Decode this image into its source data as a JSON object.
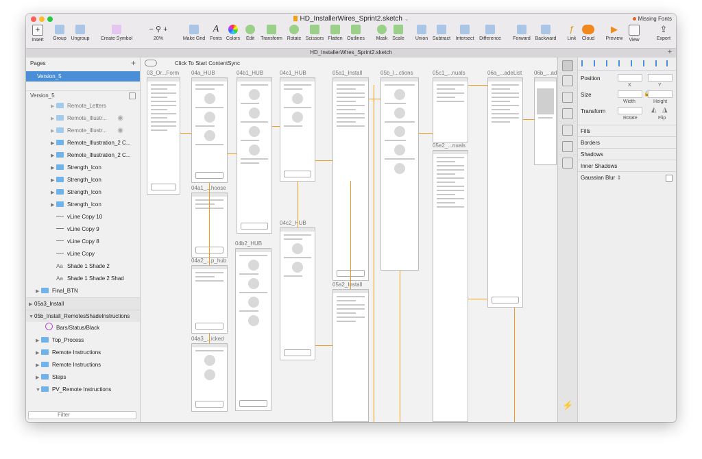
{
  "window": {
    "title": "HD_InstallerWires_Sprint2.sketch",
    "missing_fonts": "Missing Fonts",
    "tab_title": "HD_InstallerWires_Sprint2.sketch"
  },
  "toolbar": {
    "insert": "Insert",
    "group": "Group",
    "ungroup": "Ungroup",
    "create_symbol": "Create Symbol",
    "zoom": "20%",
    "make_grid": "Make Grid",
    "fonts": "Fonts",
    "colors": "Colors",
    "edit": "Edit",
    "transform": "Transform",
    "rotate": "Rotate",
    "scissors": "Scissors",
    "flatten": "Flatten",
    "outlines": "Outlines",
    "mask": "Mask",
    "scale": "Scale",
    "union": "Union",
    "subtract": "Subtract",
    "intersect": "Intersect",
    "difference": "Difference",
    "forward": "Forward",
    "backward": "Backward",
    "link": "Link",
    "cloud": "Cloud",
    "preview": "Preview",
    "view": "View",
    "export": "Export"
  },
  "pages": {
    "header": "Pages",
    "selected": "Version_5",
    "version_label": "Version_5"
  },
  "layers": [
    "Remote_Letters",
    "Remote_Illustr...",
    "Remote_Illustr...",
    "Remote_Illustration_2 C...",
    "Remote_Illustration_2 C...",
    "Strength_Icon",
    "Strength_Icon",
    "Strength_Icon",
    "Strength_Icon",
    "vLine Copy 10",
    "vLine Copy 9",
    "vLine Copy 8",
    "vLine Copy",
    "Shade 1 Shade 2",
    "Shade 1 Shade 2 Shad",
    "Final_BTN",
    "05a3_Install",
    "05b_Install_RemotesShadeInstructions",
    "Bars/Status/Black",
    "Top_Process",
    "Remote Instructions",
    "Remote Instructions",
    "Steps",
    "PV_Remote Instructions"
  ],
  "filter_placeholder": "Filter",
  "canvas": {
    "contentsync": "Click To Start ContentSync",
    "artboards": [
      "03_Or...Form",
      "04a_HUB",
      "04b1_HUB",
      "04c1_HUB",
      "05a1_Install",
      "05b_I...ctions",
      "05c1_...nuals",
      "06a_...adeList",
      "06b_...ade",
      "04a1_...hoose",
      "04b2_HUB",
      "04c2_HUB",
      "05a2_Install",
      "04a2_...p_hub",
      "04a3_...icked",
      "05e2_...nuals"
    ]
  },
  "inspector": {
    "position": "Position",
    "x": "X",
    "y": "Y",
    "size": "Size",
    "width": "Width",
    "height": "Height",
    "transform": "Transform",
    "rotate": "Rotate",
    "flip": "Flip",
    "fills": "Fills",
    "borders": "Borders",
    "shadows": "Shadows",
    "inner_shadows": "Inner Shadows",
    "gaussian_blur": "Gaussian Blur"
  },
  "colors": {
    "accent": "#4a8ed7",
    "wire": "#f39c1c"
  }
}
